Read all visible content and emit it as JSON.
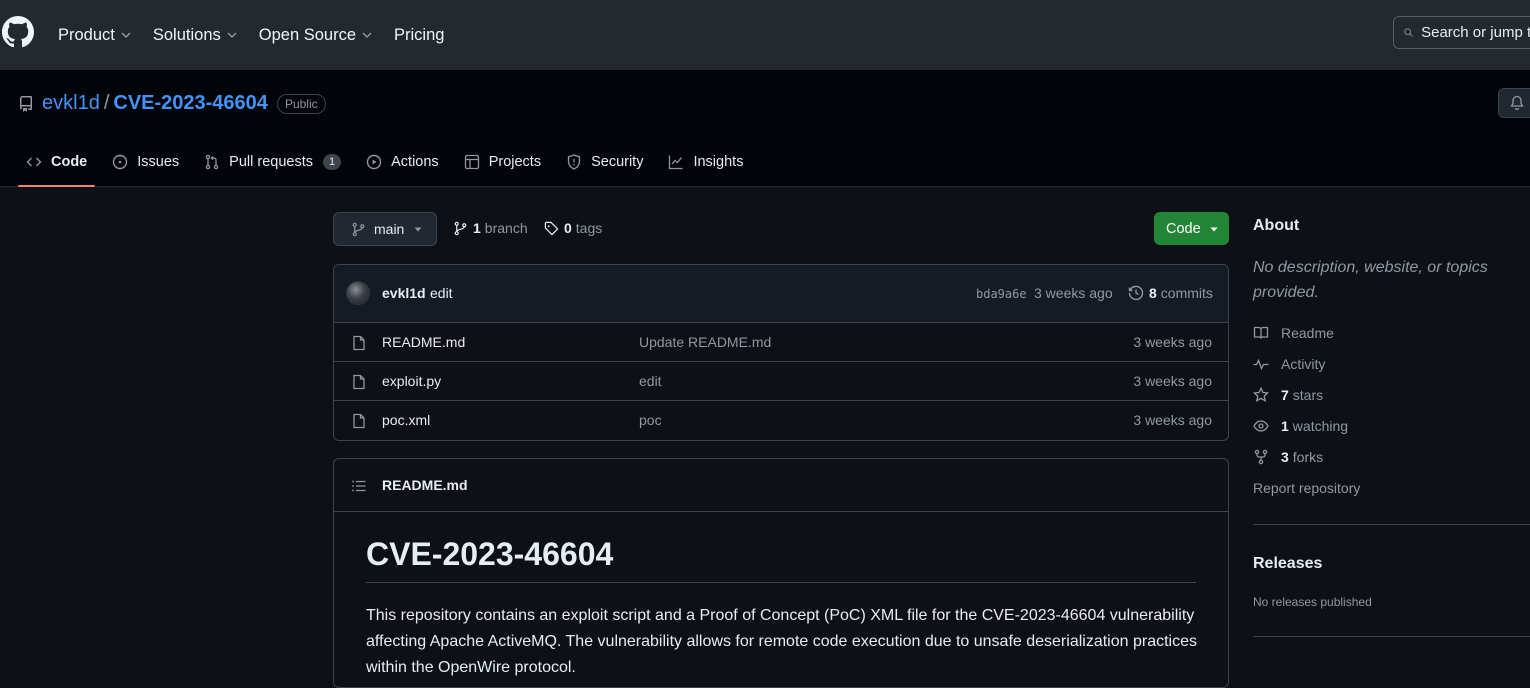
{
  "nav": {
    "product": "Product",
    "solutions": "Solutions",
    "open_source": "Open Source",
    "pricing": "Pricing",
    "search_placeholder": "Search or jump to..."
  },
  "repo": {
    "owner": "evkl1d",
    "separator": "/",
    "name": "CVE-2023-46604",
    "visibility": "Public"
  },
  "tabs": [
    {
      "label": "Code"
    },
    {
      "label": "Issues"
    },
    {
      "label": "Pull requests",
      "count": "1"
    },
    {
      "label": "Actions"
    },
    {
      "label": "Projects"
    },
    {
      "label": "Security"
    },
    {
      "label": "Insights"
    }
  ],
  "toolbar": {
    "branch": "main",
    "branch_count": "1",
    "branch_label": "branch",
    "tag_count": "0",
    "tag_label": "tags",
    "code_button": "Code"
  },
  "commit": {
    "author": "evkl1d",
    "message": "edit",
    "sha": "bda9a6e",
    "time": "3 weeks ago",
    "count": "8",
    "count_label": "commits"
  },
  "files": [
    {
      "name": "README.md",
      "message": "Update README.md",
      "time": "3 weeks ago"
    },
    {
      "name": "exploit.py",
      "message": "edit",
      "time": "3 weeks ago"
    },
    {
      "name": "poc.xml",
      "message": "poc",
      "time": "3 weeks ago"
    }
  ],
  "readme": {
    "filename": "README.md",
    "heading": "CVE-2023-46604",
    "paragraph": "This repository contains an exploit script and a Proof of Concept (PoC) XML file for the CVE-2023-46604 vulnerability affecting Apache ActiveMQ. The vulnerability allows for remote code execution due to unsafe deserialization practices within the OpenWire protocol."
  },
  "about": {
    "title": "About",
    "description": "No description, website, or topics provided.",
    "readme": "Readme",
    "activity": "Activity",
    "stars_count": "7",
    "stars_label": "stars",
    "watching_count": "1",
    "watching_label": "watching",
    "forks_count": "3",
    "forks_label": "forks",
    "report": "Report repository"
  },
  "releases": {
    "title": "Releases",
    "empty": "No releases published"
  },
  "colors": {
    "background": "#0d1117",
    "header": "#24292f",
    "link": "#4493f8",
    "primary_button": "#238636",
    "active_tab_underline": "#f78166"
  }
}
